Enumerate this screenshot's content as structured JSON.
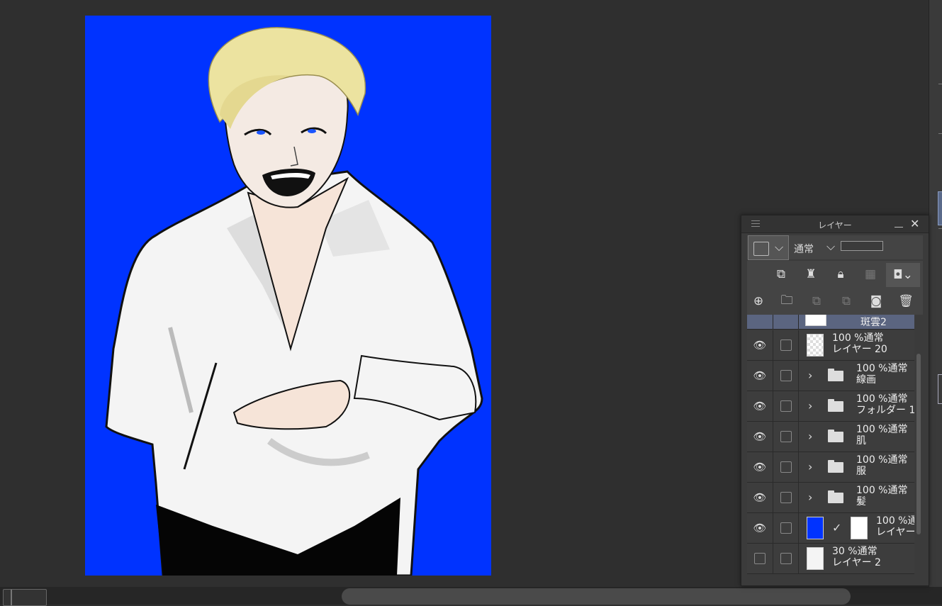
{
  "panel": {
    "title": "レイヤー",
    "blend_mode": "通常",
    "icons": {
      "menu": "hamburger-icon",
      "minimize": "minimize-icon",
      "close": "close-icon",
      "copy": "copy-layer-icon",
      "lighthouse": "reference-layer-icon",
      "lock": "lock-icon",
      "lock_transparent": "lock-transparency-icon",
      "mask": "mask-icon",
      "new_layer": "new-raster-layer-icon",
      "new_folder": "new-folder-icon",
      "transfer_down": "transfer-down-icon",
      "merge_down": "merge-down-icon",
      "layer_mask": "create-layer-mask-icon",
      "delete": "trash-icon"
    }
  },
  "layers": [
    {
      "line1": "",
      "line2": "斑雲2",
      "type": "partial"
    },
    {
      "line1": "100 %通常",
      "line2": "レイヤー 20",
      "type": "raster",
      "visible": true
    },
    {
      "line1": "100 %通常",
      "line2": "線画",
      "type": "folder",
      "visible": true
    },
    {
      "line1": "100 %通常",
      "line2": "フォルダー 1",
      "type": "folder",
      "visible": true
    },
    {
      "line1": "100 %通常",
      "line2": "肌",
      "type": "folder",
      "visible": true
    },
    {
      "line1": "100 %通常",
      "line2": "服",
      "type": "folder",
      "visible": true
    },
    {
      "line1": "100 %通常",
      "line2": "髪",
      "type": "folder",
      "visible": true
    },
    {
      "line1": "100 %通",
      "line2": "レイヤー",
      "type": "masked",
      "visible": true
    },
    {
      "line1": "30 %通常",
      "line2": "レイヤー 2",
      "type": "sketch",
      "visible": false
    }
  ],
  "canvas": {
    "background": "#0033ff",
    "subject": "illustration"
  }
}
